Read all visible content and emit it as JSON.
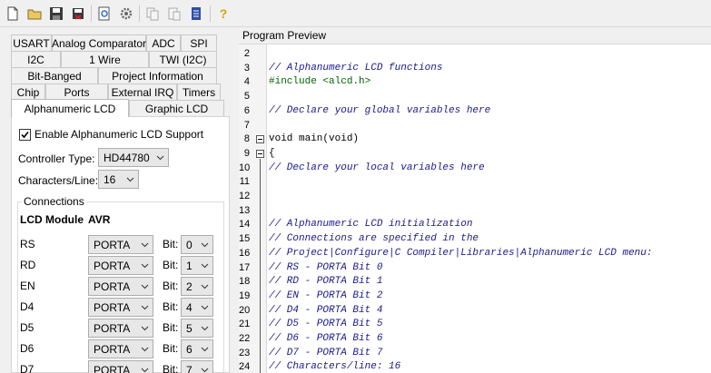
{
  "toolbar": {
    "buttons": [
      {
        "name": "new-file-icon"
      },
      {
        "name": "open-folder-icon"
      },
      {
        "name": "save-icon"
      },
      {
        "name": "save-exit-icon"
      },
      {
        "name": "preview-icon"
      },
      {
        "name": "generate-icon"
      },
      {
        "name": "copy-icon"
      },
      {
        "name": "paste-icon"
      },
      {
        "name": "notes-icon"
      },
      {
        "name": "help-icon"
      }
    ]
  },
  "tabs": {
    "row1": [
      "USART",
      "Analog Comparator",
      "ADC",
      "SPI"
    ],
    "row2": [
      "I2C",
      "1 Wire",
      "TWI (I2C)"
    ],
    "row3": [
      "Bit-Banged",
      "Project Information"
    ],
    "row4": [
      "Chip",
      "Ports",
      "External IRQ",
      "Timers"
    ],
    "row5": [
      "Alphanumeric LCD",
      "Graphic LCD"
    ]
  },
  "lcd": {
    "enable_label": "Enable Alphanumeric LCD Support",
    "controller_label": "Controller Type:",
    "controller_value": "HD44780",
    "chars_label": "Characters/Line:",
    "chars_value": "16",
    "connections_title": "Connections",
    "col_module": "LCD Module",
    "col_avr": "AVR",
    "bit_label": "Bit:",
    "pins": [
      {
        "name": "RS",
        "port": "PORTA",
        "bit": "0"
      },
      {
        "name": "RD",
        "port": "PORTA",
        "bit": "1"
      },
      {
        "name": "EN",
        "port": "PORTA",
        "bit": "2"
      },
      {
        "name": "D4",
        "port": "PORTA",
        "bit": "4"
      },
      {
        "name": "D5",
        "port": "PORTA",
        "bit": "5"
      },
      {
        "name": "D6",
        "port": "PORTA",
        "bit": "6"
      },
      {
        "name": "D7",
        "port": "PORTA",
        "bit": "7"
      }
    ]
  },
  "preview": {
    "title": "Program Preview",
    "lines": [
      {
        "n": "2",
        "text": "",
        "kind": "plain"
      },
      {
        "n": "3",
        "text": "// Alphanumeric LCD functions",
        "kind": "comment"
      },
      {
        "n": "4",
        "text": "#include <alcd.h>",
        "kind": "directive"
      },
      {
        "n": "5",
        "text": "",
        "kind": "plain"
      },
      {
        "n": "6",
        "text": "// Declare your global variables here",
        "kind": "comment"
      },
      {
        "n": "7",
        "text": "",
        "kind": "plain"
      },
      {
        "n": "8",
        "text": "void main(void)",
        "kind": "plain"
      },
      {
        "n": "9",
        "text": "{",
        "kind": "plain"
      },
      {
        "n": "10",
        "text": "// Declare your local variables here",
        "kind": "comment"
      },
      {
        "n": "11",
        "text": "",
        "kind": "plain"
      },
      {
        "n": "12",
        "text": "",
        "kind": "plain"
      },
      {
        "n": "13",
        "text": "",
        "kind": "plain"
      },
      {
        "n": "14",
        "text": "// Alphanumeric LCD initialization",
        "kind": "comment"
      },
      {
        "n": "15",
        "text": "// Connections are specified in the",
        "kind": "comment"
      },
      {
        "n": "16",
        "text": "// Project|Configure|C Compiler|Libraries|Alphanumeric LCD menu:",
        "kind": "comment"
      },
      {
        "n": "17",
        "text": "// RS - PORTA Bit 0",
        "kind": "comment"
      },
      {
        "n": "18",
        "text": "// RD - PORTA Bit 1",
        "kind": "comment"
      },
      {
        "n": "19",
        "text": "// EN - PORTA Bit 2",
        "kind": "comment"
      },
      {
        "n": "20",
        "text": "// D4 - PORTA Bit 4",
        "kind": "comment"
      },
      {
        "n": "21",
        "text": "// D5 - PORTA Bit 5",
        "kind": "comment"
      },
      {
        "n": "22",
        "text": "// D6 - PORTA Bit 6",
        "kind": "comment"
      },
      {
        "n": "23",
        "text": "// D7 - PORTA Bit 7",
        "kind": "comment"
      },
      {
        "n": "24",
        "text": "// Characters/line: 16",
        "kind": "comment"
      }
    ]
  }
}
